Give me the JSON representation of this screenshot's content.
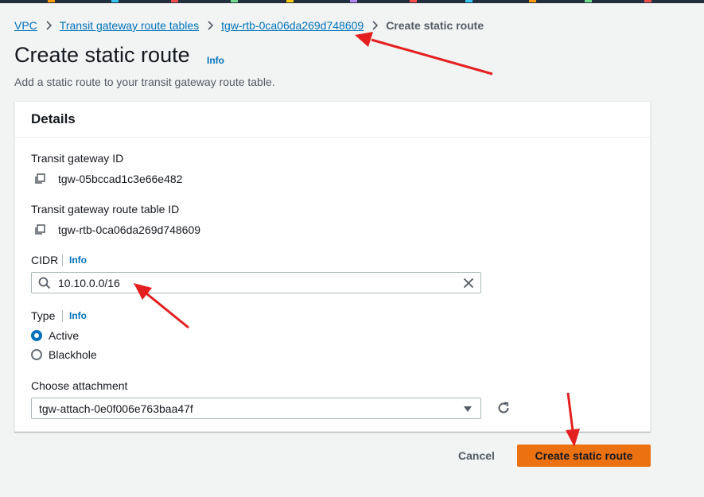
{
  "colors": {
    "accent_link": "#0073bb",
    "primary_button": "#ec7211",
    "annotation_arrow": "#e41f1f"
  },
  "breadcrumb": {
    "items": [
      "VPC",
      "Transit gateway route tables",
      "tgw-rtb-0ca06da269d748609"
    ],
    "current": "Create static route"
  },
  "header": {
    "title": "Create static route",
    "info": "Info",
    "description": "Add a static route to your transit gateway route table."
  },
  "details": {
    "title": "Details",
    "transit_gateway_id_label": "Transit gateway ID",
    "transit_gateway_id": "tgw-05bccad1c3e66e482",
    "route_table_id_label": "Transit gateway route table ID",
    "route_table_id": "tgw-rtb-0ca06da269d748609",
    "cidr_label": "CIDR",
    "cidr_info": "Info",
    "cidr_value": "10.10.0.0/16",
    "type_label": "Type",
    "type_info": "Info",
    "type_options": [
      {
        "label": "Active",
        "selected": true
      },
      {
        "label": "Blackhole",
        "selected": false
      }
    ],
    "attachment_label": "Choose attachment",
    "attachment_value": "tgw-attach-0e0f006e763baa47f"
  },
  "actions": {
    "cancel": "Cancel",
    "submit": "Create static route"
  },
  "icons": {
    "breadcrumb_separator": "chevron-right-icon",
    "copy": "copy-icon",
    "search": "search-icon",
    "clear": "close-icon",
    "dropdown": "caret-down-icon",
    "refresh": "refresh-icon"
  }
}
